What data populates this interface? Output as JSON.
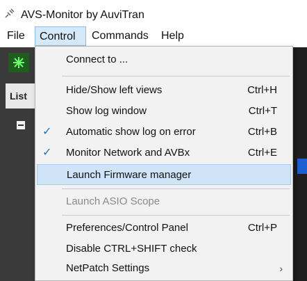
{
  "window": {
    "title": "AVS-Monitor by AuviTran",
    "icon": "app-plug-icon"
  },
  "menubar": {
    "items": [
      "File",
      "Control",
      "Commands",
      "Help"
    ],
    "active": "Control"
  },
  "background": {
    "list_tab": "List"
  },
  "control_menu": {
    "items": [
      {
        "label": "Connect to ...",
        "shortcut": "",
        "checked": false,
        "disabled": false,
        "highlighted": false,
        "submenu": false
      },
      {
        "label": "Hide/Show left views",
        "shortcut": "Ctrl+H",
        "checked": false,
        "disabled": false,
        "highlighted": false,
        "submenu": false
      },
      {
        "label": "Show log window",
        "shortcut": "Ctrl+T",
        "checked": false,
        "disabled": false,
        "highlighted": false,
        "submenu": false
      },
      {
        "label": "Automatic show log on error",
        "shortcut": "Ctrl+B",
        "checked": true,
        "disabled": false,
        "highlighted": false,
        "submenu": false
      },
      {
        "label": "Monitor Network and AVBx",
        "shortcut": "Ctrl+E",
        "checked": true,
        "disabled": false,
        "highlighted": false,
        "submenu": false
      },
      {
        "label": "Launch Firmware manager",
        "shortcut": "",
        "checked": false,
        "disabled": false,
        "highlighted": true,
        "submenu": false
      },
      {
        "label": "Launch ASIO Scope",
        "shortcut": "",
        "checked": false,
        "disabled": true,
        "highlighted": false,
        "submenu": false
      },
      {
        "label": "Preferences/Control Panel",
        "shortcut": "Ctrl+P",
        "checked": false,
        "disabled": false,
        "highlighted": false,
        "submenu": false
      },
      {
        "label": "Disable CTRL+SHIFT check",
        "shortcut": "",
        "checked": false,
        "disabled": false,
        "highlighted": false,
        "submenu": false
      },
      {
        "label": "NetPatch Settings",
        "shortcut": "",
        "checked": false,
        "disabled": false,
        "highlighted": false,
        "submenu": true
      }
    ],
    "check_glyph": "✓",
    "submenu_glyph": "›"
  },
  "colors": {
    "highlight": "#cfe4f7",
    "menu_active": "#d6e9f8",
    "check": "#2a6fb0"
  }
}
